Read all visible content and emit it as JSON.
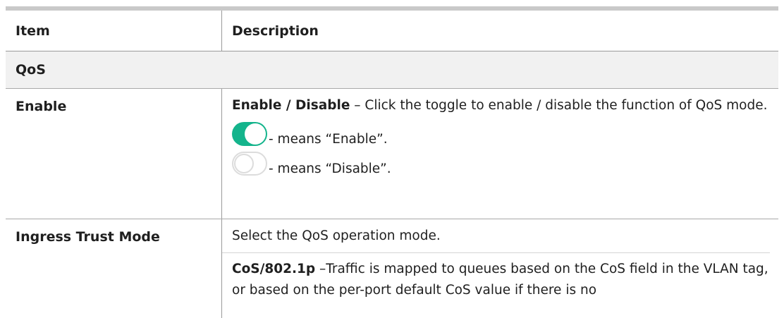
{
  "table": {
    "header": {
      "item": "Item",
      "description": "Description"
    },
    "section_title": "QoS",
    "rows": [
      {
        "item": "Enable",
        "desc_bold": "Enable / Disable",
        "desc_text": " – Click the toggle to enable / disable the function of QoS mode.",
        "toggle_on_text": "- means “Enable”.",
        "toggle_off_text": "- means “Disable”."
      },
      {
        "item": "Ingress Trust Mode",
        "desc_text1": "Select the QoS operation mode.",
        "desc_bold2": "CoS/802.1p",
        "desc_text2": " –Traffic is mapped to queues based on the CoS field in the VLAN tag, or based on the per-port default CoS value if there is no"
      }
    ]
  },
  "colors": {
    "toggle_on": "#14b48c",
    "toggle_off_border": "#dcdcdc"
  },
  "icons": {
    "toggle_on": "toggle-on-icon",
    "toggle_off": "toggle-off-icon"
  }
}
